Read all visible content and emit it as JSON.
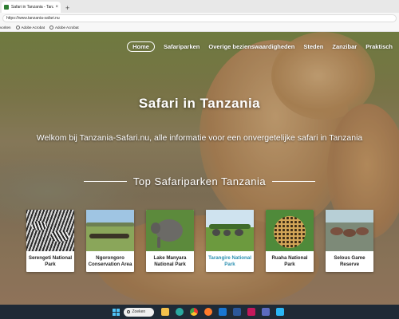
{
  "browser": {
    "tab_title": "Safari in Tanzania - Tanzania-sa",
    "tab_close": "×",
    "new_tab": "+",
    "url": "https://www.tanzania-safari.nu",
    "bookmarks": [
      "voriten",
      "Adobe Acrobat",
      "Adobe Acrobat"
    ]
  },
  "nav": {
    "items": [
      {
        "label": "Home",
        "active": true
      },
      {
        "label": "Safariparken",
        "active": false
      },
      {
        "label": "Overige bezienswaardigheden",
        "active": false
      },
      {
        "label": "Steden",
        "active": false
      },
      {
        "label": "Zanzibar",
        "active": false
      },
      {
        "label": "Praktisch",
        "active": false
      }
    ]
  },
  "hero": {
    "title": "Safari in Tanzania",
    "subtitle": "Welkom bij Tanzania-Safari.nu, alle informatie voor een onvergetelijke safari in Tanzania"
  },
  "section": {
    "heading": "Top Safariparken Tanzania"
  },
  "parks": [
    {
      "name": "Serengeti National Park",
      "image": "zebras-icon",
      "active": false
    },
    {
      "name": "Ngorongoro Conservation Area",
      "image": "wildebeest-herd-icon",
      "active": false
    },
    {
      "name": "Lake Manyara National Park",
      "image": "elephant-icon",
      "active": false
    },
    {
      "name": "Tarangire National Park",
      "image": "elephant-herd-icon",
      "active": true
    },
    {
      "name": "Ruaha National Park",
      "image": "leopard-icon",
      "active": false
    },
    {
      "name": "Selous Game Reserve",
      "image": "hippos-icon",
      "active": false
    }
  ],
  "taskbar": {
    "search_label": "Zoeken",
    "apps": [
      "file-explorer-icon",
      "edge-icon",
      "chrome-icon",
      "firefox-icon",
      "outlook-icon",
      "word-icon",
      "photos-icon",
      "teams-icon",
      "store-icon"
    ]
  },
  "colors": {
    "accent_link": "#2a8fb0",
    "taskbar": "#1f2a36"
  }
}
